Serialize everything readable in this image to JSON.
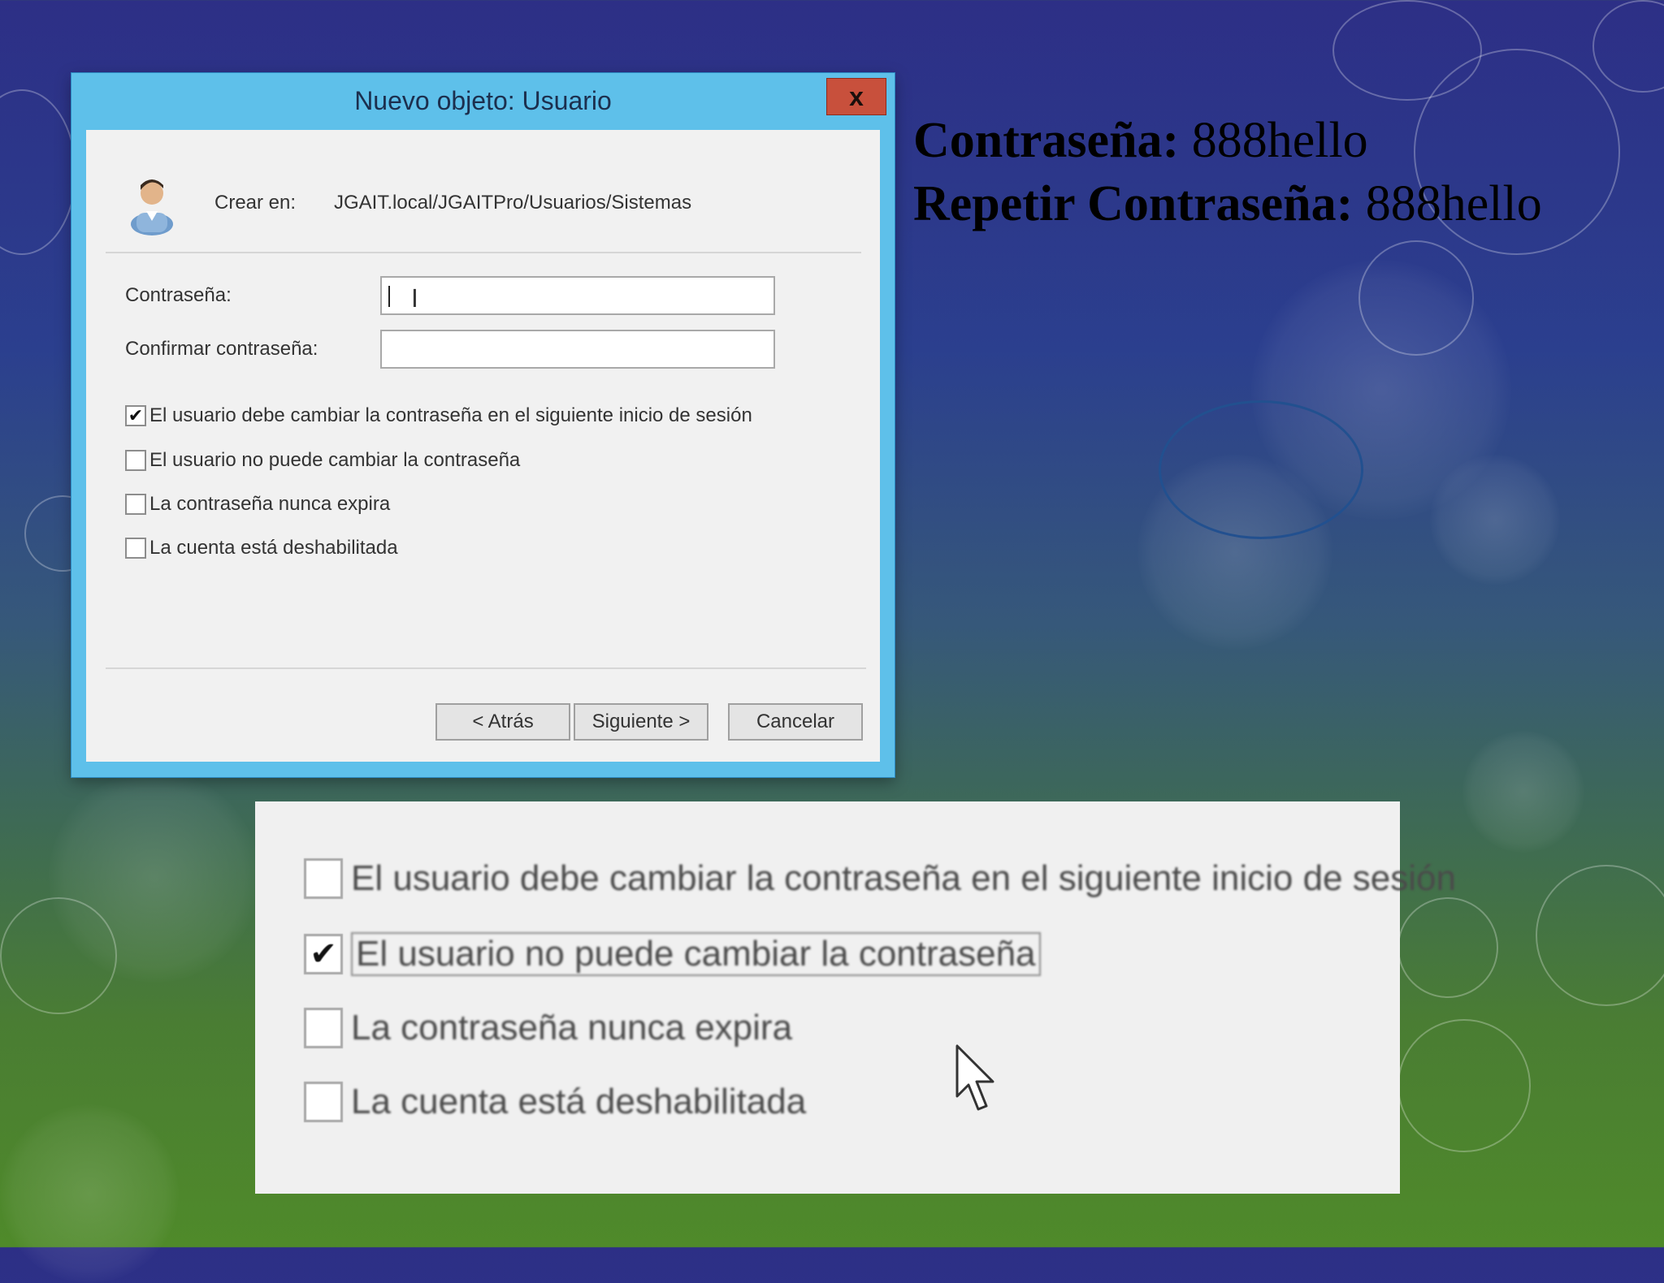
{
  "dialog": {
    "title": "Nuevo objeto: Usuario",
    "close_label": "x",
    "crear_en_label": "Crear en:",
    "crear_en_path": "JGAIT.local/JGAITPro/Usuarios/Sistemas",
    "password_label": "Contraseña:",
    "confirm_label": "Confirmar contraseña:",
    "password_value": "",
    "confirm_value": "",
    "checkboxes": [
      {
        "label": "El usuario debe cambiar la contraseña en el siguiente inicio de sesión",
        "checked": true,
        "mark": "✔"
      },
      {
        "label": "El usuario no puede cambiar la contraseña",
        "checked": false,
        "mark": ""
      },
      {
        "label": "La contraseña nunca expira",
        "checked": false,
        "mark": ""
      },
      {
        "label": "La cuenta está deshabilitada",
        "checked": false,
        "mark": ""
      }
    ],
    "buttons": {
      "back": "< Atrás",
      "next": "Siguiente >",
      "cancel": "Cancelar"
    }
  },
  "note": {
    "password_label": "Contraseña:",
    "password_value": "888hello",
    "repeat_label": "Repetir Contraseña:",
    "repeat_value": "888hello"
  },
  "zoom": {
    "checkboxes": [
      {
        "label": "El usuario debe cambiar la contraseña en el siguiente inicio de sesión",
        "checked": false,
        "mark": ""
      },
      {
        "label": "El usuario no puede cambiar la contraseña",
        "checked": true,
        "mark": "✔"
      },
      {
        "label": "La contraseña nunca expira",
        "checked": false,
        "mark": ""
      },
      {
        "label": "La cuenta está deshabilitada",
        "checked": false,
        "mark": ""
      }
    ]
  },
  "colors": {
    "dialog_frame": "#5ec0ea",
    "close_button": "#c8503c",
    "highlight_ellipse": "#22508f"
  }
}
